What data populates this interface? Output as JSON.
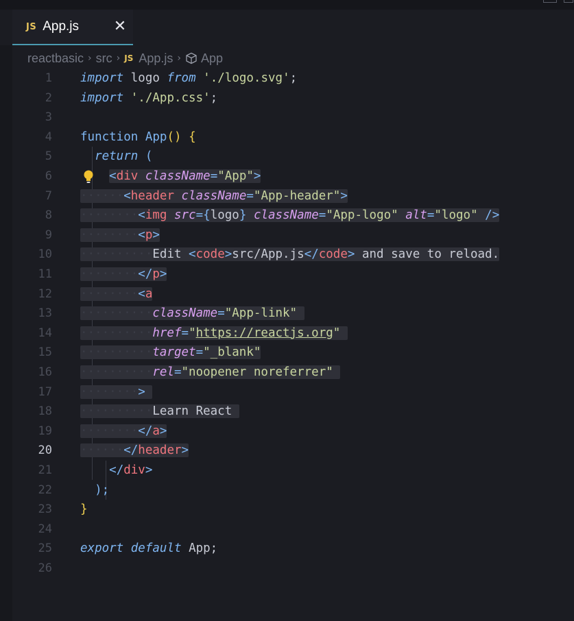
{
  "tab": {
    "badge": "JS",
    "title": "App.js",
    "close": "✕"
  },
  "breadcrumb": {
    "items": [
      "reactbasic",
      "src"
    ],
    "file_badge": "JS",
    "file": "App.js",
    "symbol": "App"
  },
  "editor": {
    "active_line": 20,
    "line_numbers": [
      "1",
      "2",
      "3",
      "4",
      "5",
      "6",
      "7",
      "8",
      "9",
      "10",
      "11",
      "12",
      "13",
      "14",
      "15",
      "16",
      "17",
      "18",
      "19",
      "20",
      "21",
      "22",
      "23",
      "24",
      "25",
      "26"
    ],
    "tokens": {
      "import": "import",
      "logo": "logo",
      "from": "from",
      "logo_path": "'./logo.svg'",
      "semi": ";",
      "css_path": "'./App.css'",
      "function": "function",
      "app": "App",
      "parens": "()",
      "open_brace": "{",
      "return": "return",
      "open_paren": "(",
      "lt": "<",
      "gt": ">",
      "lt_slash": "</",
      "self_close": "/>",
      "eq": "=",
      "div": "div",
      "header": "header",
      "img": "img",
      "p": "p",
      "a": "a",
      "code": "code",
      "className": "className",
      "src": "src",
      "alt": "alt",
      "href": "href",
      "target": "target",
      "rel": "rel",
      "v_app": "\"App\"",
      "v_app_header": "\"App-header\"",
      "v_app_logo": "\"App-logo\"",
      "v_logo": "\"logo\"",
      "v_app_link": "\"App-link\"",
      "q": "\"",
      "v_url": "https://reactjs.org",
      "v_blank": "\"_blank\"",
      "v_rel": "\"noopener noreferrer\"",
      "lbrace": "{",
      "rbrace": "}",
      "edit": "Edit ",
      "src_app_js": "src/App.js",
      "and_save": " and save to reload.",
      "learn_react": "Learn React",
      "close_paren_semi": ");",
      "close_brace": "}",
      "export": "export",
      "default": "default",
      "app_semi": "App;"
    }
  },
  "colors": {
    "background": "#1b1c22",
    "tab_underline": "#4a9ab0",
    "js_badge": "#e6c35c",
    "lightbulb": "#f0c030"
  }
}
